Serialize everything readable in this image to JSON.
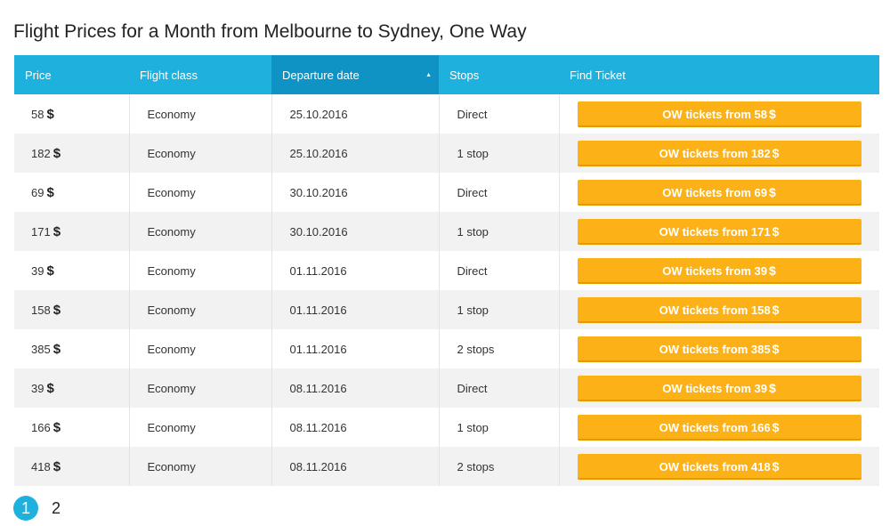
{
  "title": "Flight Prices for a Month from Melbourne to Sydney, One Way",
  "columns": {
    "price": "Price",
    "flight_class": "Flight class",
    "departure_date": "Departure date",
    "stops": "Stops",
    "find_ticket": "Find Ticket"
  },
  "sort": {
    "column": "departure_date",
    "direction": "ascending",
    "icon": "sort-up-icon"
  },
  "currency": "$",
  "button_prefix": "OW tickets from",
  "rows": [
    {
      "price": "58",
      "flight_class": "Economy",
      "date": "25.10.2016",
      "stops": "Direct"
    },
    {
      "price": "182",
      "flight_class": "Economy",
      "date": "25.10.2016",
      "stops": "1 stop"
    },
    {
      "price": "69",
      "flight_class": "Economy",
      "date": "30.10.2016",
      "stops": "Direct"
    },
    {
      "price": "171",
      "flight_class": "Economy",
      "date": "30.10.2016",
      "stops": "1 stop"
    },
    {
      "price": "39",
      "flight_class": "Economy",
      "date": "01.11.2016",
      "stops": "Direct"
    },
    {
      "price": "158",
      "flight_class": "Economy",
      "date": "01.11.2016",
      "stops": "1 stop"
    },
    {
      "price": "385",
      "flight_class": "Economy",
      "date": "01.11.2016",
      "stops": "2 stops"
    },
    {
      "price": "39",
      "flight_class": "Economy",
      "date": "08.11.2016",
      "stops": "Direct"
    },
    {
      "price": "166",
      "flight_class": "Economy",
      "date": "08.11.2016",
      "stops": "1 stop"
    },
    {
      "price": "418",
      "flight_class": "Economy",
      "date": "08.11.2016",
      "stops": "2 stops"
    }
  ],
  "pagination": {
    "pages": [
      "1",
      "2"
    ],
    "current": "1"
  },
  "colors": {
    "header": "#1eb1de",
    "header_sorted": "#0f93c4",
    "button": "#fcb216",
    "row_alt": "#f2f2f2",
    "page_active": "#1eb1de"
  }
}
